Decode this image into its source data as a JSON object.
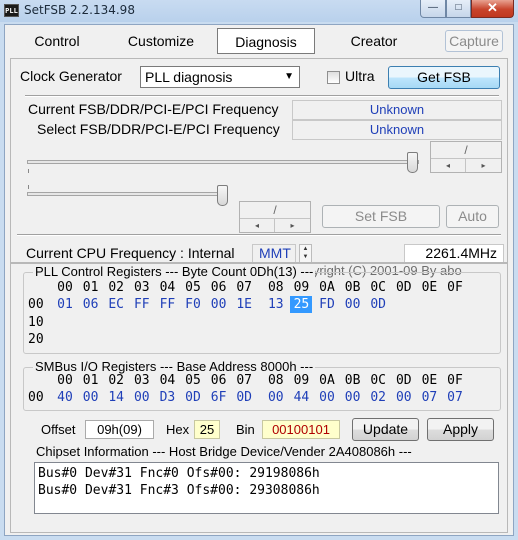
{
  "window": {
    "title": "SetFSB 2.2.134.98",
    "app_icon": "PLL",
    "min_glyph": "—",
    "max_glyph": "□",
    "close_glyph": "✕"
  },
  "tabs": [
    {
      "label": "Control"
    },
    {
      "label": "Customize"
    },
    {
      "label": "Diagnosis",
      "active": true
    },
    {
      "label": "Creator"
    }
  ],
  "capture_label": "Capture",
  "clock": {
    "label": "Clock Generator",
    "selected": "PLL diagnosis",
    "ultra_label": "Ultra",
    "ultra_checked": false,
    "get_fsb_label": "Get FSB"
  },
  "frequency": {
    "current_label": "Current FSB/DDR/PCI-E/PCI Frequency",
    "current_value": "Unknown",
    "select_label": "Select FSB/DDR/PCI-E/PCI Frequency",
    "select_value": "Unknown"
  },
  "spin1": {
    "value": "/",
    "left": "◂",
    "right": "▸"
  },
  "spin2": {
    "value": "/",
    "left": "◂",
    "right": "▸"
  },
  "set_fsb_label": "Set FSB",
  "auto_label": "Auto",
  "cpu": {
    "label": "Current CPU Frequency : Internal",
    "source": "MMT",
    "value": "2261.4MHz"
  },
  "copyright": "Copyright (C) 2001-09 By abo",
  "pll": {
    "title": "PLL Control Registers  --- Byte Count 0Dh(13) ---",
    "columns": [
      "00",
      "01",
      "02",
      "03",
      "04",
      "05",
      "06",
      "07",
      "08",
      "09",
      "0A",
      "0B",
      "0C",
      "0D",
      "0E",
      "0F"
    ],
    "rows": [
      {
        "addr": "00",
        "values": [
          "01",
          "06",
          "EC",
          "FF",
          "FF",
          "F0",
          "00",
          "1E",
          "13",
          "25",
          "FD",
          "00",
          "0D",
          "",
          "",
          ""
        ],
        "selected_index": 9
      },
      {
        "addr": "10",
        "values": []
      },
      {
        "addr": "20",
        "values": []
      }
    ]
  },
  "smbus": {
    "title": "SMBus I/O Registers  --- Base Address 8000h ---",
    "columns": [
      "00",
      "01",
      "02",
      "03",
      "04",
      "05",
      "06",
      "07",
      "08",
      "09",
      "0A",
      "0B",
      "0C",
      "0D",
      "0E",
      "0F"
    ],
    "rows": [
      {
        "addr": "00",
        "values": [
          "40",
          "00",
          "14",
          "00",
          "D3",
          "0D",
          "6F",
          "0D",
          "00",
          "44",
          "00",
          "00",
          "02",
          "00",
          "07",
          "07"
        ]
      }
    ]
  },
  "edit": {
    "offset_label": "Offset",
    "offset_value": "09h(09)",
    "hex_label": "Hex",
    "hex_value": "25",
    "bin_label": "Bin",
    "bin_value": "00100101",
    "update_label": "Update",
    "apply_label": "Apply"
  },
  "chipset": {
    "title": "Chipset Information  --- Host Bridge Device/Vender 2A408086h ---",
    "lines": [
      "Bus#0 Dev#31 Fnc#0 Ofs#00: 29198086h",
      "Bus#0 Dev#31 Fnc#3 Ofs#00: 29308086h"
    ]
  }
}
